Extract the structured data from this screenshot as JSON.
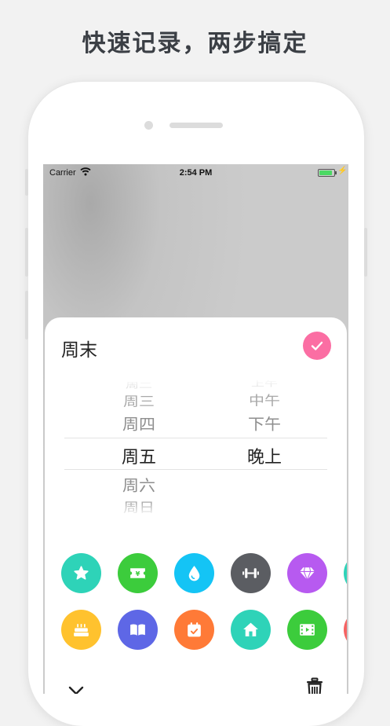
{
  "headline": "快速记录，两步搞定",
  "status_bar": {
    "carrier": "Carrier",
    "time": "2:54 PM",
    "battery_level": 1.0
  },
  "sheet": {
    "title": "周末",
    "confirm_color": "#fb6ea3",
    "day_picker": {
      "options": [
        "周二",
        "周三",
        "周四",
        "周五",
        "周六",
        "周日"
      ],
      "selected": "周五"
    },
    "time_picker": {
      "options": [
        "上午",
        "中午",
        "下午",
        "晚上"
      ],
      "selected": "晚上"
    }
  },
  "icons": [
    {
      "name": "star-icon",
      "color": "#2ed3b8"
    },
    {
      "name": "ticket-icon",
      "color": "#3ccc3c"
    },
    {
      "name": "water-drop-icon",
      "color": "#14c4f5"
    },
    {
      "name": "dumbbell-icon",
      "color": "#5b5d62"
    },
    {
      "name": "diamond-icon",
      "color": "#b75af0"
    },
    {
      "name": "cake-icon",
      "color": "#ffc22e"
    },
    {
      "name": "book-icon",
      "color": "#5e67e6"
    },
    {
      "name": "calendar-icon",
      "color": "#ff7a37"
    },
    {
      "name": "home-icon",
      "color": "#2ed3b8"
    },
    {
      "name": "film-icon",
      "color": "#3ccc3c"
    }
  ],
  "bottom_bar": {
    "collapse_icon": "chevron-down-icon",
    "delete_icon": "trash-icon"
  }
}
